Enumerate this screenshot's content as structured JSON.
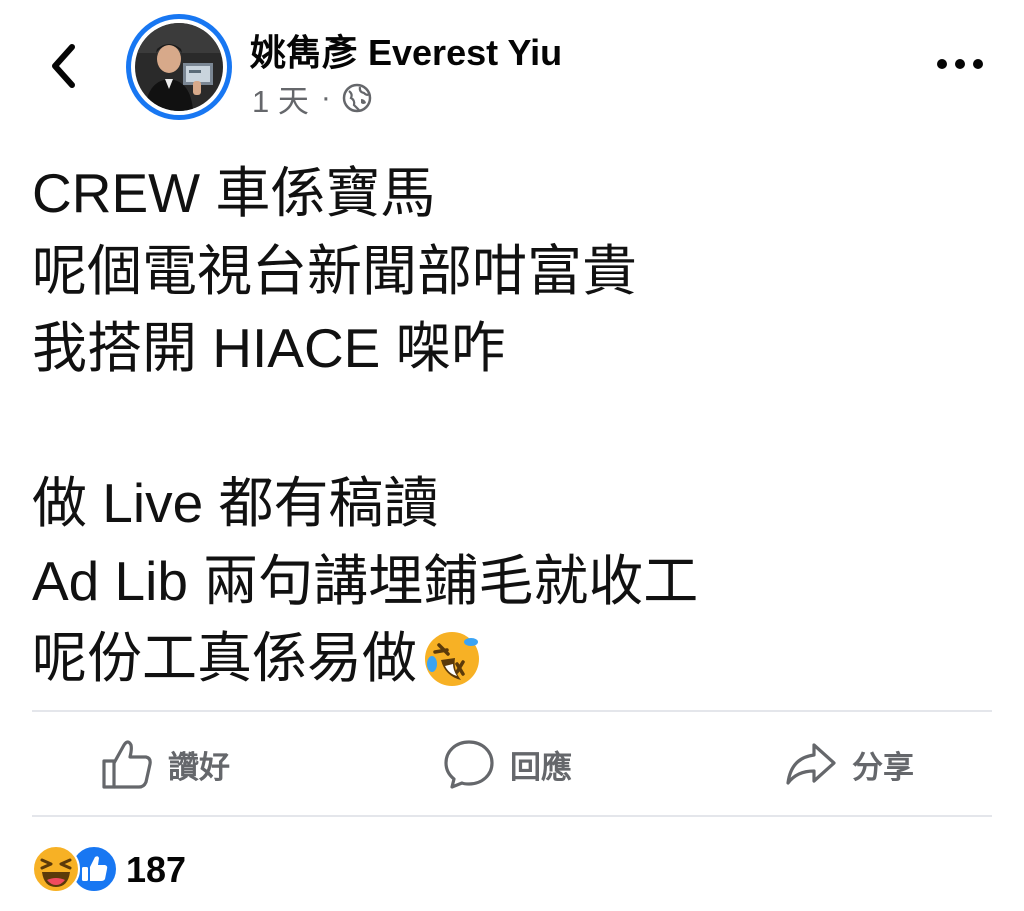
{
  "header": {
    "back_icon": "chevron-left-icon",
    "author_name": "姚雋彥 Everest Yiu",
    "timestamp": "1 天",
    "separator": "·",
    "privacy_icon": "globe-icon",
    "more_icon": "more-horizontal-icon"
  },
  "post": {
    "lines": [
      "CREW 車係寶馬",
      "呢個電視台新聞部咁富貴",
      "我搭開 HIACE 㗎咋",
      "",
      "做 Live 都有稿讀",
      "Ad Lib 兩句講埋鋪毛就收工",
      "呢份工真係易做"
    ],
    "trailing_emoji": "rolling-on-floor-laughing-emoji"
  },
  "actions": {
    "like_label": "讚好",
    "comment_label": "回應",
    "share_label": "分享"
  },
  "reactions": {
    "types": [
      "haha",
      "like"
    ],
    "count": "187"
  },
  "colors": {
    "accent": "#1877f2",
    "secondary_text": "#65676b",
    "divider": "#e4e6eb",
    "haha_yellow": "#f7b125"
  }
}
